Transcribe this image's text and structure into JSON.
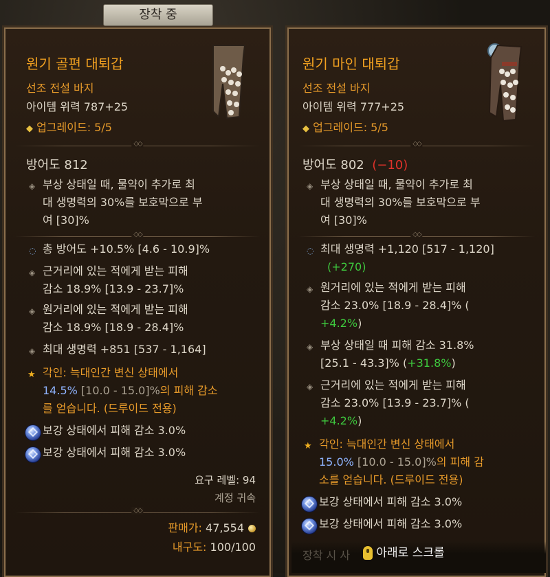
{
  "header": {
    "tab_label": "장착 중"
  },
  "left": {
    "name": "원기 골편 대퇴갑",
    "type": "선조 전설 바지",
    "power": "아이템 위력 787+25",
    "upgrade": "업그레이드: 5/5",
    "armor": "방어도 812",
    "implicit": [
      "부상 상태일 때, 물약이 추가로 최",
      "대 생명력의 30%를 보호막으로 부",
      "여 [30]%"
    ],
    "affix1": "총 방어도 +10.5% [4.6 - 10.9]%",
    "affix2": [
      "근거리에 있는 적에게 받는 피해",
      "감소 18.9% [13.9 - 23.7]%"
    ],
    "affix3": [
      "원거리에 있는 적에게 받는 피해",
      "감소 18.9% [18.9 - 28.4]%"
    ],
    "affix4": "최대 생명력 +851 [537 - 1,164]",
    "aspect_prefix": "각인: ",
    "aspect_line1": "늑대인간 변신 상태에서",
    "aspect_value": "14.5%",
    "aspect_range": " [10.0 - 15.0]%",
    "aspect_line2_rest": "의 피해 감소",
    "aspect_line3": "를 얻습니다. (드루이드 전용)",
    "socket1": "보강 상태에서 피해 감소 3.0%",
    "socket2": "보강 상태에서 피해 감소 3.0%",
    "req_level": "요구 레벨: 94",
    "bound": "계정 귀속",
    "sell_label": "판매가:",
    "sell_value": "47,554",
    "durability_label": "내구도:",
    "durability_value": "100/100"
  },
  "right": {
    "name": "원기 마인 대퇴갑",
    "type": "선조 전설 바지",
    "power": "아이템 위력 777+25",
    "upgrade": "업그레이드: 5/5",
    "armor": "방어도 802",
    "armor_diff": "(−10)",
    "implicit": [
      "부상 상태일 때, 물약이 추가로 최",
      "대 생명력의 30%를 보호막으로 부",
      "여 [30]%"
    ],
    "affix1": "최대 생명력 +1,120 [517 - 1,120]",
    "affix1_diff": "(+270)",
    "affix2": [
      "원거리에 있는 적에게 받는 피해",
      "감소 23.0% [18.9 - 28.4]% ("
    ],
    "affix2_diff": "+4.2%",
    "affix3a": "부상 상태일 때 피해 감소 31.8%",
    "affix3b": "[25.1 - 43.3]% (",
    "affix3_diff": "+31.8%",
    "affix4": [
      "근거리에 있는 적에게 받는 피해",
      "감소 23.0% [13.9 - 23.7]% ("
    ],
    "affix4_diff": "+4.2%",
    "aspect_prefix": "각인: ",
    "aspect_line1": "늑대인간 변신 상태에서",
    "aspect_value": "15.0%",
    "aspect_range": " [10.0 - 15.0]%",
    "aspect_line2_rest": "의 피해 감",
    "aspect_line3": "소를 얻습니다. (드루이드 전용)",
    "socket1": "보강 상태에서 피해 감소 3.0%",
    "socket2": "보강 상태에서 피해 감소 3.0%",
    "partial_footer": "장착 시 사",
    "scroll_label": "아래로 스크롤"
  },
  "icons": {
    "upgrade": "diamond-icon",
    "affix": "bullet-icon",
    "aspect": "star-icon",
    "socket": "gem-icon",
    "gold": "coin-icon",
    "scroll": "mouse-scroll-icon"
  },
  "colors": {
    "legendary": "#f0a020",
    "negative": "#e0322a",
    "positive": "#3ec83e"
  }
}
